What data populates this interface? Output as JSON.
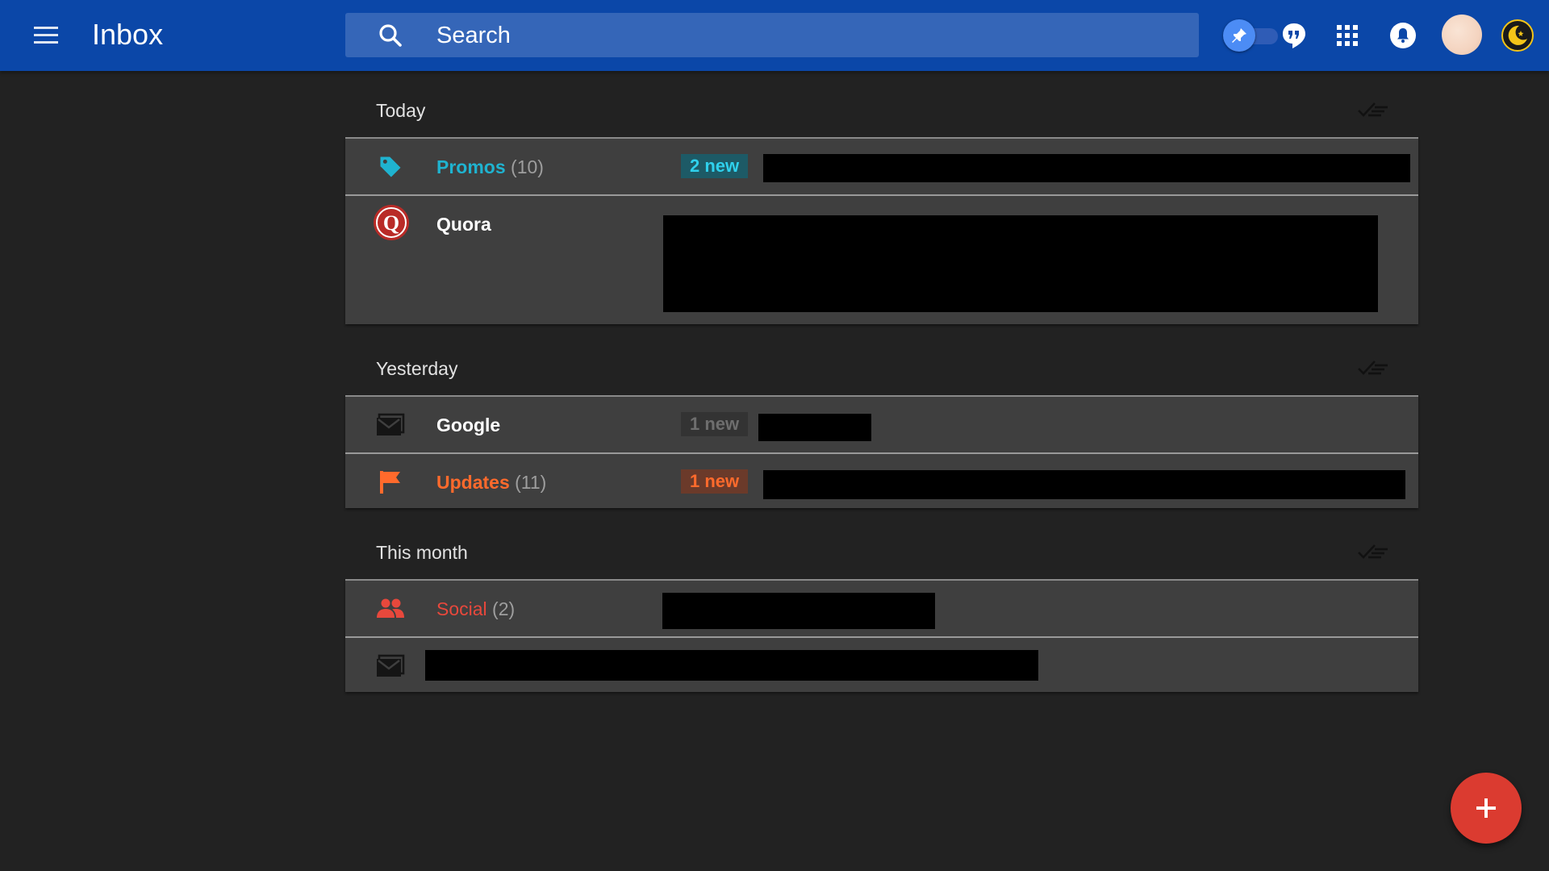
{
  "header": {
    "title": "Inbox",
    "search_placeholder": "Search",
    "menu_icon": "hamburger-menu-icon",
    "pin_toggle_icon": "pin-icon",
    "hangouts_icon": "hangouts-quote-icon",
    "apps_icon": "apps-grid-icon",
    "notifications_icon": "bell-icon",
    "theme_icon": "moon-icon",
    "accent": "#0b47a8"
  },
  "sections": [
    {
      "label": "Today",
      "rows": [
        {
          "name": "Promos",
          "count": "(10)",
          "badge": "2 new",
          "color": "#1fb3d0",
          "icon": "tag-icon"
        },
        {
          "name": "Quora",
          "icon": "quora-logo-icon"
        }
      ]
    },
    {
      "label": "Yesterday",
      "rows": [
        {
          "name": "Google",
          "badge": "1 new",
          "icon": "mail-icon"
        },
        {
          "name": "Updates",
          "count": "(11)",
          "badge": "1 new",
          "color": "#ff6a2c",
          "icon": "flag-icon"
        }
      ]
    },
    {
      "label": "This month",
      "rows": [
        {
          "name": "Social",
          "count": "(2)",
          "color": "#e8483c",
          "icon": "people-icon"
        },
        {
          "icon": "mail-icon"
        }
      ]
    }
  ],
  "fab": {
    "icon": "plus-icon",
    "color": "#db3b30"
  }
}
